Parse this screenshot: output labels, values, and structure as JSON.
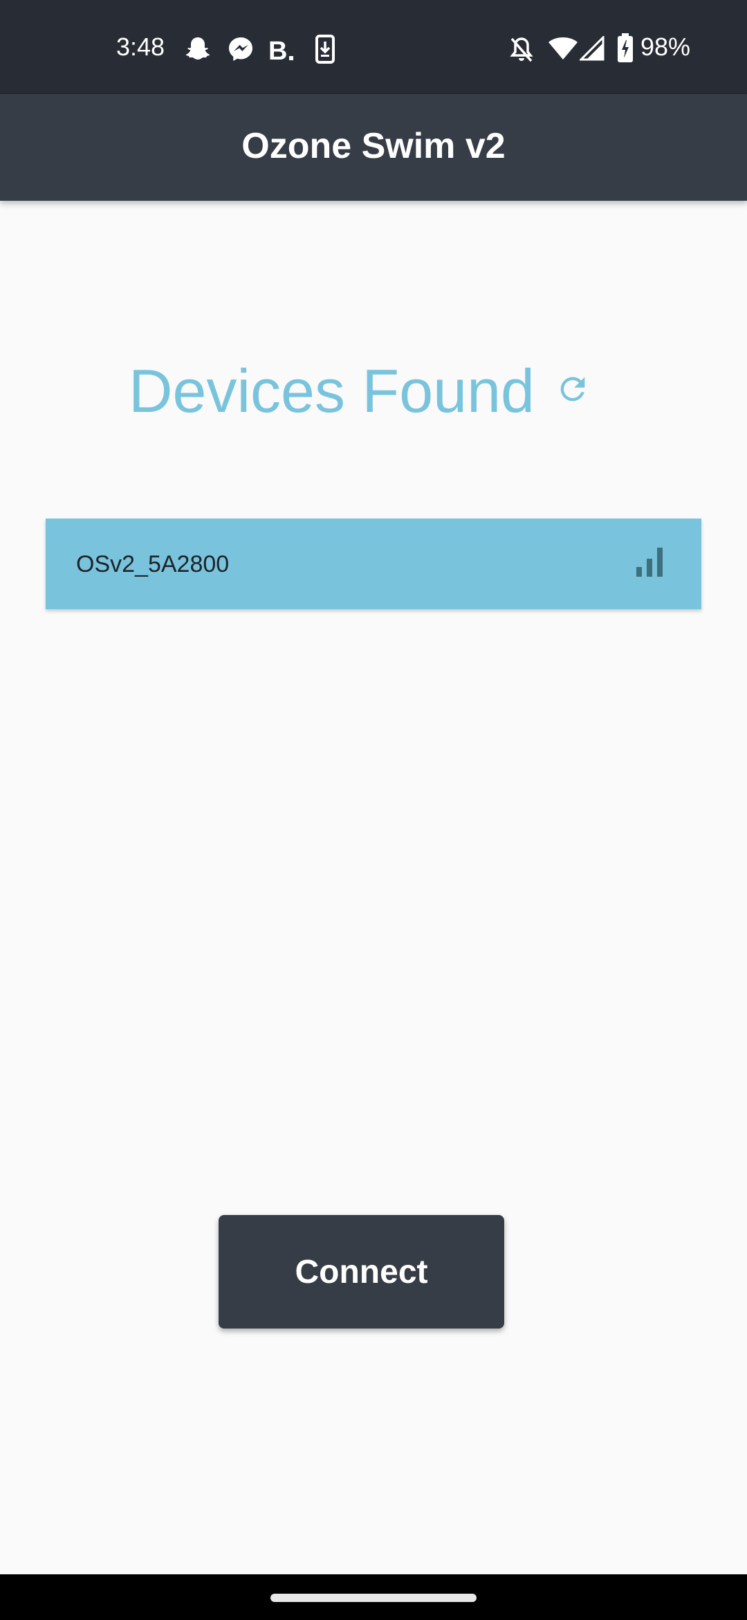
{
  "status_bar": {
    "time": "3:48",
    "battery_percent": "98%",
    "notification_icons": [
      "snapchat-icon",
      "messenger-icon",
      "booking-icon",
      "download-icon"
    ],
    "system_icons": [
      "bell-off-icon",
      "wifi-icon",
      "signal-icon",
      "battery-charging-icon"
    ]
  },
  "app_bar": {
    "title": "Ozone Swim v2"
  },
  "main": {
    "heading": "Devices Found",
    "refresh_icon": "refresh-icon",
    "devices": [
      {
        "name": "OSv2_5A2800",
        "signal_icon": "signal-strength-icon"
      }
    ],
    "connect_label": "Connect"
  },
  "colors": {
    "status_bar_bg": "#282d35",
    "app_bar_bg": "#373d46",
    "accent": "#79c4dc",
    "background": "#fafafa",
    "button_bg": "#373d46"
  }
}
